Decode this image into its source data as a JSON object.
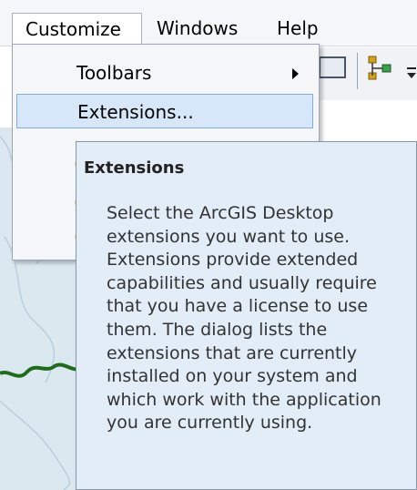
{
  "menubar": {
    "items": [
      {
        "label": "Customize"
      },
      {
        "label": "Windows"
      },
      {
        "label": "Help"
      }
    ]
  },
  "menu": {
    "items": [
      {
        "label": "Toolbars",
        "has_submenu": true
      },
      {
        "label": "Extensions...",
        "highlighted": true
      }
    ]
  },
  "tooltip": {
    "title": "Extensions",
    "lines": [
      "Select the ArcGIS Desktop",
      "extensions you want to use.",
      "Extensions provide extended",
      "capabilities and usually require",
      "that you have a license to use",
      "them. The dialog lists the",
      "extensions that are currently",
      "installed on your system and",
      "which work with the application",
      "you are currently using."
    ]
  },
  "colors": {
    "menu_highlight": "#d5e7f9",
    "tooltip_bg": "#e3edf7",
    "river": "#1f6d1a"
  },
  "icons": {
    "toolbar_icon_1": "window-icon",
    "toolbar_icon_2": "model-builder-icon",
    "toolbar_overflow": "chevron-down-icon"
  }
}
